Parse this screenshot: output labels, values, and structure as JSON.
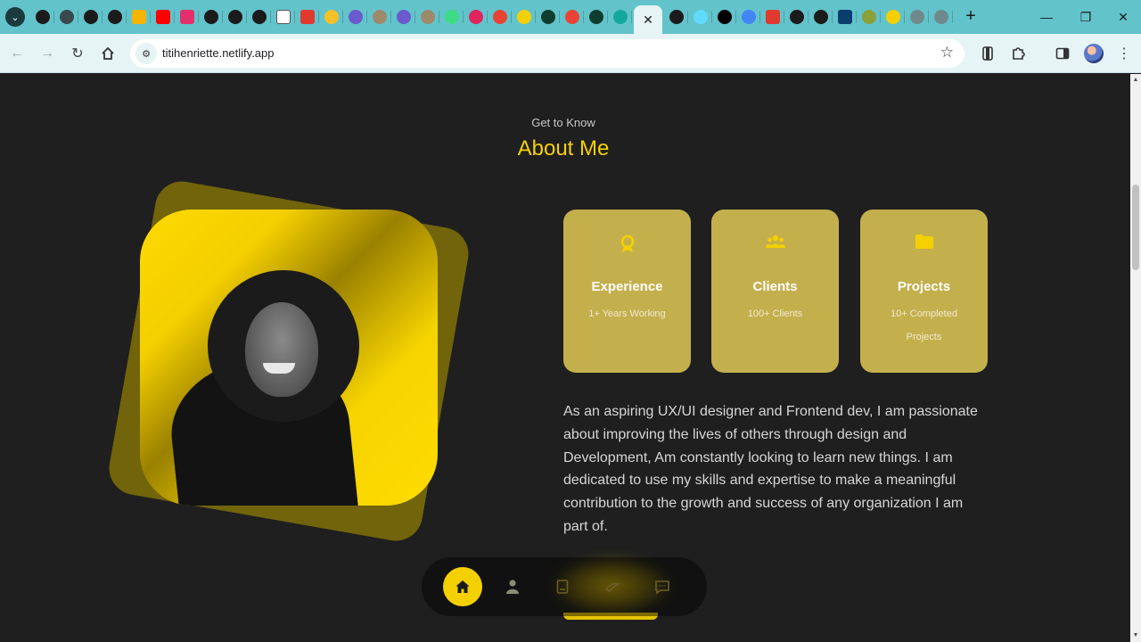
{
  "browser": {
    "url": "titihenriette.netlify.app",
    "tabs": [
      {
        "icon": "github-icon",
        "color": "#1b1b1b"
      },
      {
        "icon": "olx-icon",
        "color": "#3a4a4e"
      },
      {
        "icon": "github-icon",
        "color": "#1b1b1b"
      },
      {
        "icon": "github-icon",
        "color": "#1b1b1b"
      },
      {
        "icon": "slides-icon",
        "color": "#f4b400"
      },
      {
        "icon": "youtube-icon",
        "color": "#ff0000"
      },
      {
        "icon": "instagram-icon",
        "color": "#e1306c"
      },
      {
        "icon": "github-icon",
        "color": "#1b1b1b"
      },
      {
        "icon": "github-icon",
        "color": "#1b1b1b"
      },
      {
        "icon": "github-icon",
        "color": "#1b1b1b"
      },
      {
        "icon": "wikipedia-icon",
        "color": "#ffffff"
      },
      {
        "icon": "notion-red-icon",
        "color": "#e03a2f"
      },
      {
        "icon": "maps-pin-icon",
        "color": "#f6c026"
      },
      {
        "icon": "code-icon",
        "color": "#6a5acd"
      },
      {
        "icon": "globe-icon",
        "color": "#9c8a6a"
      },
      {
        "icon": "code-icon",
        "color": "#6a5acd"
      },
      {
        "icon": "globe-icon",
        "color": "#9c8a6a"
      },
      {
        "icon": "android-icon",
        "color": "#3ddc84"
      },
      {
        "icon": "badge-13-icon",
        "color": "#e0245e"
      },
      {
        "icon": "gmail-icon",
        "color": "#ea4335"
      },
      {
        "icon": "sun-icon",
        "color": "#f5d000"
      },
      {
        "icon": "openai-icon",
        "color": "#0f3d2e"
      },
      {
        "icon": "gmail-icon",
        "color": "#ea4335"
      },
      {
        "icon": "openai-icon",
        "color": "#0f3d2e"
      },
      {
        "icon": "diamond-icon",
        "color": "#13a89e"
      }
    ],
    "tabs_after": [
      {
        "icon": "github-icon",
        "color": "#1b1b1b"
      },
      {
        "icon": "react-icon",
        "color": "#61dafb"
      },
      {
        "icon": "next-icon",
        "color": "#000000"
      },
      {
        "icon": "chrome-icon",
        "color": "#4285f4"
      },
      {
        "icon": "notion-red-icon",
        "color": "#e03a2f"
      },
      {
        "icon": "framer-icon",
        "color": "#1b1b1b"
      },
      {
        "icon": "figma-icon",
        "color": "#1b1b1b"
      },
      {
        "icon": "azure-icon",
        "color": "#0b3c6e"
      },
      {
        "icon": "globe-icon",
        "color": "#8aa03a"
      },
      {
        "icon": "sun-icon",
        "color": "#f5d000"
      },
      {
        "icon": "globe-icon",
        "color": "#6f8a8c"
      },
      {
        "icon": "globe-icon",
        "color": "#6f8a8c"
      }
    ],
    "active_tab_close": "✕"
  },
  "section": {
    "kicker": "Get to Know",
    "title": "About Me"
  },
  "cards": [
    {
      "icon": "award-icon",
      "title": "Experience",
      "subtitle": "1+ Years Working"
    },
    {
      "icon": "users-icon",
      "title": "Clients",
      "subtitle": "100+ Clients"
    },
    {
      "icon": "folder-icon",
      "title": "Projects",
      "subtitle": "10+ Completed Projects"
    }
  ],
  "bio": "As an aspiring UX/UI designer and Frontend dev, I am passionate about improving the lives of others through design and Development, Am constantly looking to learn new things. I am dedicated to use my skills and expertise to make a meaningful contribution to the growth and success of any organization I am part of.",
  "nav": [
    {
      "icon": "home-icon",
      "active": true
    },
    {
      "icon": "user-icon",
      "active": false
    },
    {
      "icon": "book-icon",
      "active": false
    },
    {
      "icon": "services-icon",
      "active": false
    },
    {
      "icon": "message-icon",
      "active": false
    }
  ],
  "colors": {
    "accent": "#f5d000",
    "card": "#c4af4d",
    "background": "#1f1f1f"
  }
}
